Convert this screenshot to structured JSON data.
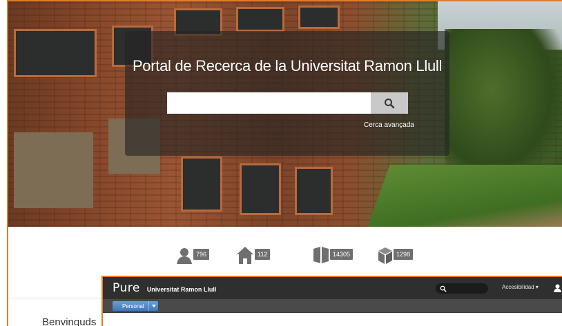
{
  "portal": {
    "title": "Portal de Recerca de la Universitat Ramon Llull",
    "search_placeholder": "",
    "advanced_search": "Cerca avançada"
  },
  "stats": [
    {
      "icon": "person-icon",
      "count": "796"
    },
    {
      "icon": "house-icon",
      "count": "112"
    },
    {
      "icon": "book-icon",
      "count": "14305"
    },
    {
      "icon": "cube-icon",
      "count": "1298"
    }
  ],
  "welcome": "Benvinguds",
  "pure": {
    "logo": "Pure",
    "org_name": "Universitat Ramon Llull",
    "accessibility": "Accesibilidad ▾",
    "tab_label": "Personal"
  },
  "colors": {
    "frame": "#e07b2a",
    "overlay": "rgba(35,35,35,0.62)",
    "pure_bar": "#2f2f2f",
    "tab_blue": "#3f79b8"
  }
}
